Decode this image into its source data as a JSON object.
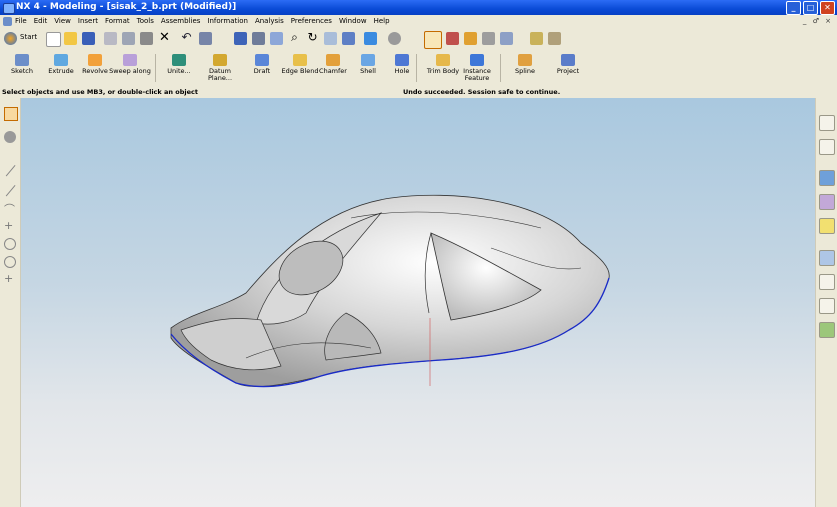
{
  "window": {
    "title": "NX 4 - Modeling - [sisak_2_b.prt (Modified)]"
  },
  "menu": {
    "items": [
      "File",
      "Edit",
      "View",
      "Insert",
      "Format",
      "Tools",
      "Assemblies",
      "Information",
      "Analysis",
      "Preferences",
      "Window",
      "Help"
    ],
    "right_controls": "_ ♂ ×"
  },
  "toolbar1": {
    "start_label": "Start"
  },
  "toolbar2": {
    "tools": [
      "Sketch",
      "Extrude",
      "Revolve",
      "Sweep along",
      "Unite...",
      "Datum Plane...",
      "Draft",
      "Edge Blend",
      "Chamfer",
      "Shell",
      "Hole",
      "Trim Body",
      "Instance Feature",
      "Spline",
      "Project"
    ]
  },
  "status": {
    "prompt": "Select objects and use MB3, or double-click an object",
    "message": "Undo succeeded. Session safe to continue."
  },
  "colors": {
    "title_blue": "#0A4BD6",
    "edge_highlight": "#1A2BC8",
    "viewport_top": "#A9C8DF",
    "viewport_bottom": "#EEEEEF",
    "part_gray": "#C8C8C8"
  }
}
